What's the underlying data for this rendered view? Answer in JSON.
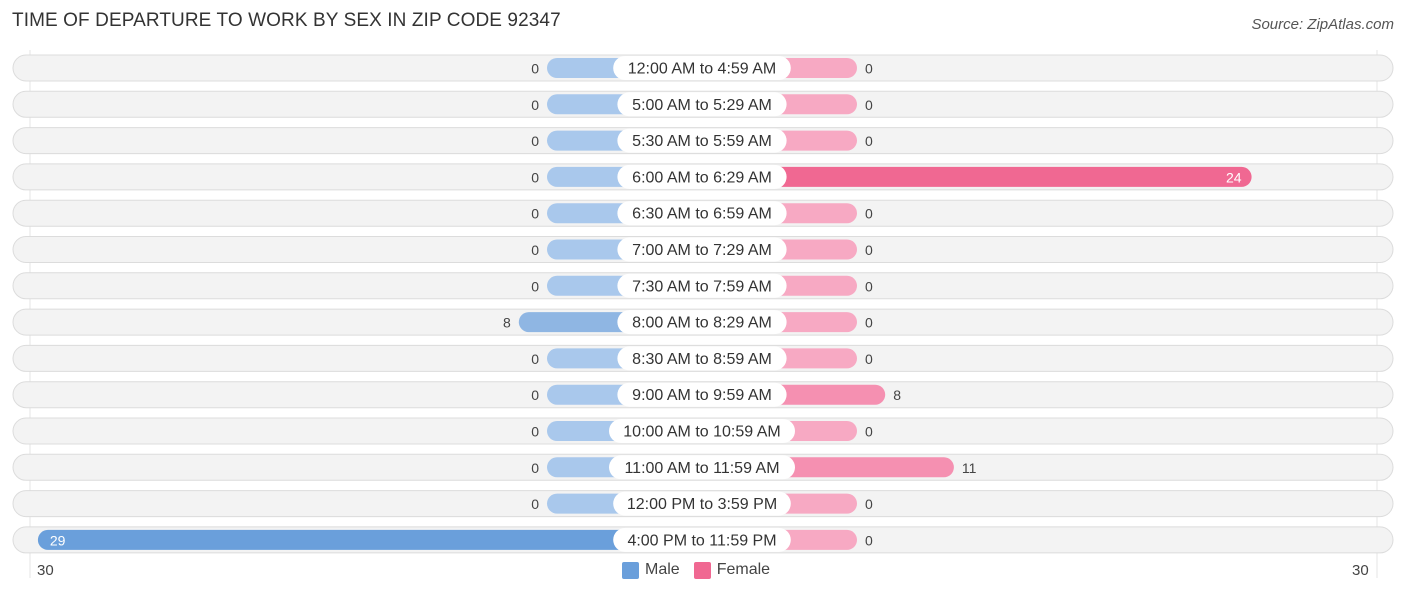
{
  "title": "TIME OF DEPARTURE TO WORK BY SEX IN ZIP CODE 92347",
  "source": "Source: ZipAtlas.com",
  "colors": {
    "male_strong": "#6a9fdb",
    "male_light": "#a9c8ec",
    "female_strong": "#f06892",
    "female_mid": "#f590b1",
    "female_light": "#f7a9c3",
    "row_bg": "#f2f2f2"
  },
  "legend": [
    {
      "label": "Male",
      "color": "#6a9fdb"
    },
    {
      "label": "Female",
      "color": "#f06892"
    }
  ],
  "axis": {
    "left_label": "30",
    "right_label": "30"
  },
  "chart_data": {
    "type": "bar",
    "orientation": "horizontal-diverging",
    "title": "TIME OF DEPARTURE TO WORK BY SEX IN ZIP CODE 92347",
    "categories": [
      "12:00 AM to 4:59 AM",
      "5:00 AM to 5:29 AM",
      "5:30 AM to 5:59 AM",
      "6:00 AM to 6:29 AM",
      "6:30 AM to 6:59 AM",
      "7:00 AM to 7:29 AM",
      "7:30 AM to 7:59 AM",
      "8:00 AM to 8:29 AM",
      "8:30 AM to 8:59 AM",
      "9:00 AM to 9:59 AM",
      "10:00 AM to 10:59 AM",
      "11:00 AM to 11:59 AM",
      "12:00 PM to 3:59 PM",
      "4:00 PM to 11:59 PM"
    ],
    "series": [
      {
        "name": "Male",
        "values": [
          0,
          0,
          0,
          0,
          0,
          0,
          0,
          8,
          0,
          0,
          0,
          0,
          0,
          29
        ]
      },
      {
        "name": "Female",
        "values": [
          0,
          0,
          0,
          24,
          0,
          0,
          0,
          0,
          0,
          8,
          0,
          11,
          0,
          0
        ]
      }
    ],
    "xlim": [
      -30,
      30
    ],
    "xlabel": "",
    "ylabel": "",
    "legend_position": "bottom-center",
    "grid": false
  }
}
